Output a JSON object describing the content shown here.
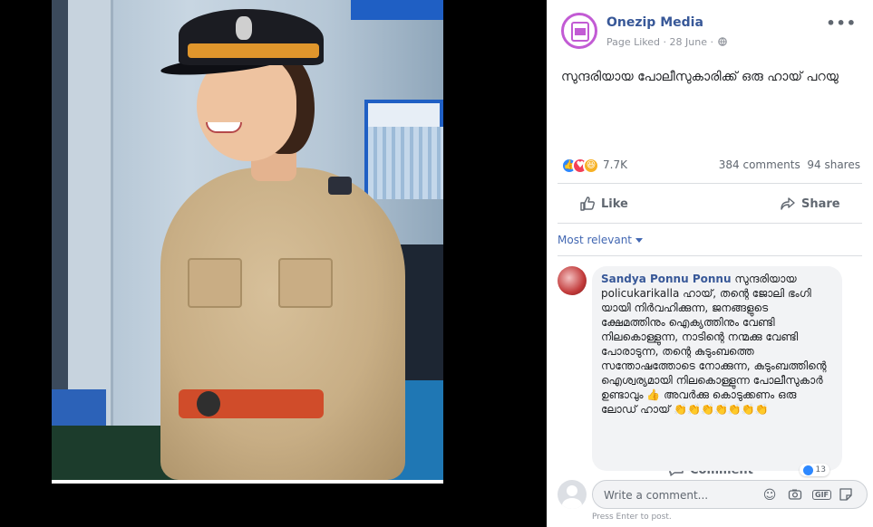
{
  "post": {
    "page_name": "Onezip Media",
    "meta": "Page Liked · 28 June ·",
    "text": "സുന്ദരിയായ പോലീസുകാരിക്ക് ഒരു ഹായ് പറയു",
    "reactions_count": "7.7K",
    "comments_count": "384 comments",
    "shares_count": "94 shares"
  },
  "actions": {
    "like_label": "Like",
    "comment_label": "Comment",
    "share_label": "Share"
  },
  "comments_filter": {
    "label": "Most relevant"
  },
  "comment": {
    "author": "Sandya Ponnu Ponnu",
    "text": "സുന്ദരിയായ policukarikalla ഹായ്, തന്റെ ജോലി ഭംഗി യായി നിർവഹിക്കുന്ന, ജനങ്ങളുടെ ക്ഷേമത്തിനും ഐക്യത്തിനും വേണ്ടി നിലകൊള്ളുന്ന, നാടിന്റെ നന്മക്കു വേണ്ടി പോരാടുന്ന, തന്റെ കുടുംബത്തെ സന്തോഷത്തോടെ നോക്കുന്ന, കുടുംബത്തിന്റെ ഐശ്വര്യമായി നിലകൊള്ളുന്ന പോലീസുകാർ ഉണ്ടാവും 👍 അവർക്കു കൊടുക്കണം ഒരു ലോഡ് ഹായ് 👏👏👏👏👏👏👏",
    "reactions_count": "13"
  },
  "composer": {
    "placeholder": "Write a comment...",
    "hint": "Press Enter to post."
  },
  "colors": {
    "link_blue": "#385898",
    "like_blue": "#2d88ff",
    "love_red": "#f33e58",
    "haha_yellow": "#f7b125"
  }
}
